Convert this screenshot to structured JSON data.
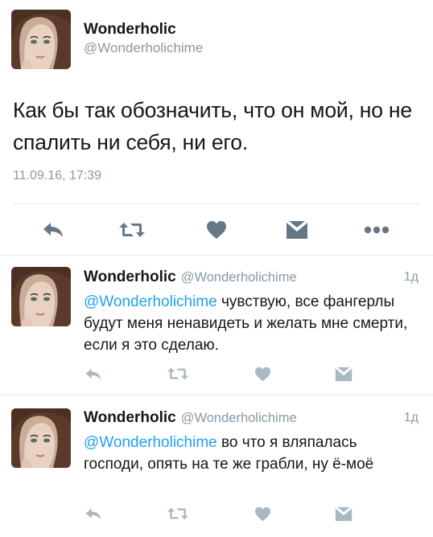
{
  "main_tweet": {
    "name": "Wonderholic",
    "handle": "@Wonderholichime",
    "text": "Как бы так обозначить,  что он мой, но не спалить ни себя,  ни его.",
    "timestamp": "11.09.16, 17:39",
    "actions": [
      "reply-icon",
      "retweet-icon",
      "like-icon",
      "message-icon",
      "more-icon"
    ]
  },
  "replies": [
    {
      "name": "Wonderholic",
      "handle": "@Wonderholichime",
      "time": "1д",
      "mention": "@Wonderholichime",
      "text": " чувствую,  все фангерлы будут меня ненавидеть и желать мне смерти,  если я это сделаю."
    },
    {
      "name": "Wonderholic",
      "handle": "@Wonderholichime",
      "time": "1д",
      "mention": "@Wonderholichime",
      "text": " во что я вляпалась господи,  опять на те же грабли,  ну ё-моё"
    }
  ],
  "colors": {
    "text": "#14171a",
    "muted": "#8899a6",
    "accent": "#1da1f2",
    "divider": "#e1e8ed",
    "icon_main": "#657786",
    "icon_reply": "#aab8c2"
  }
}
